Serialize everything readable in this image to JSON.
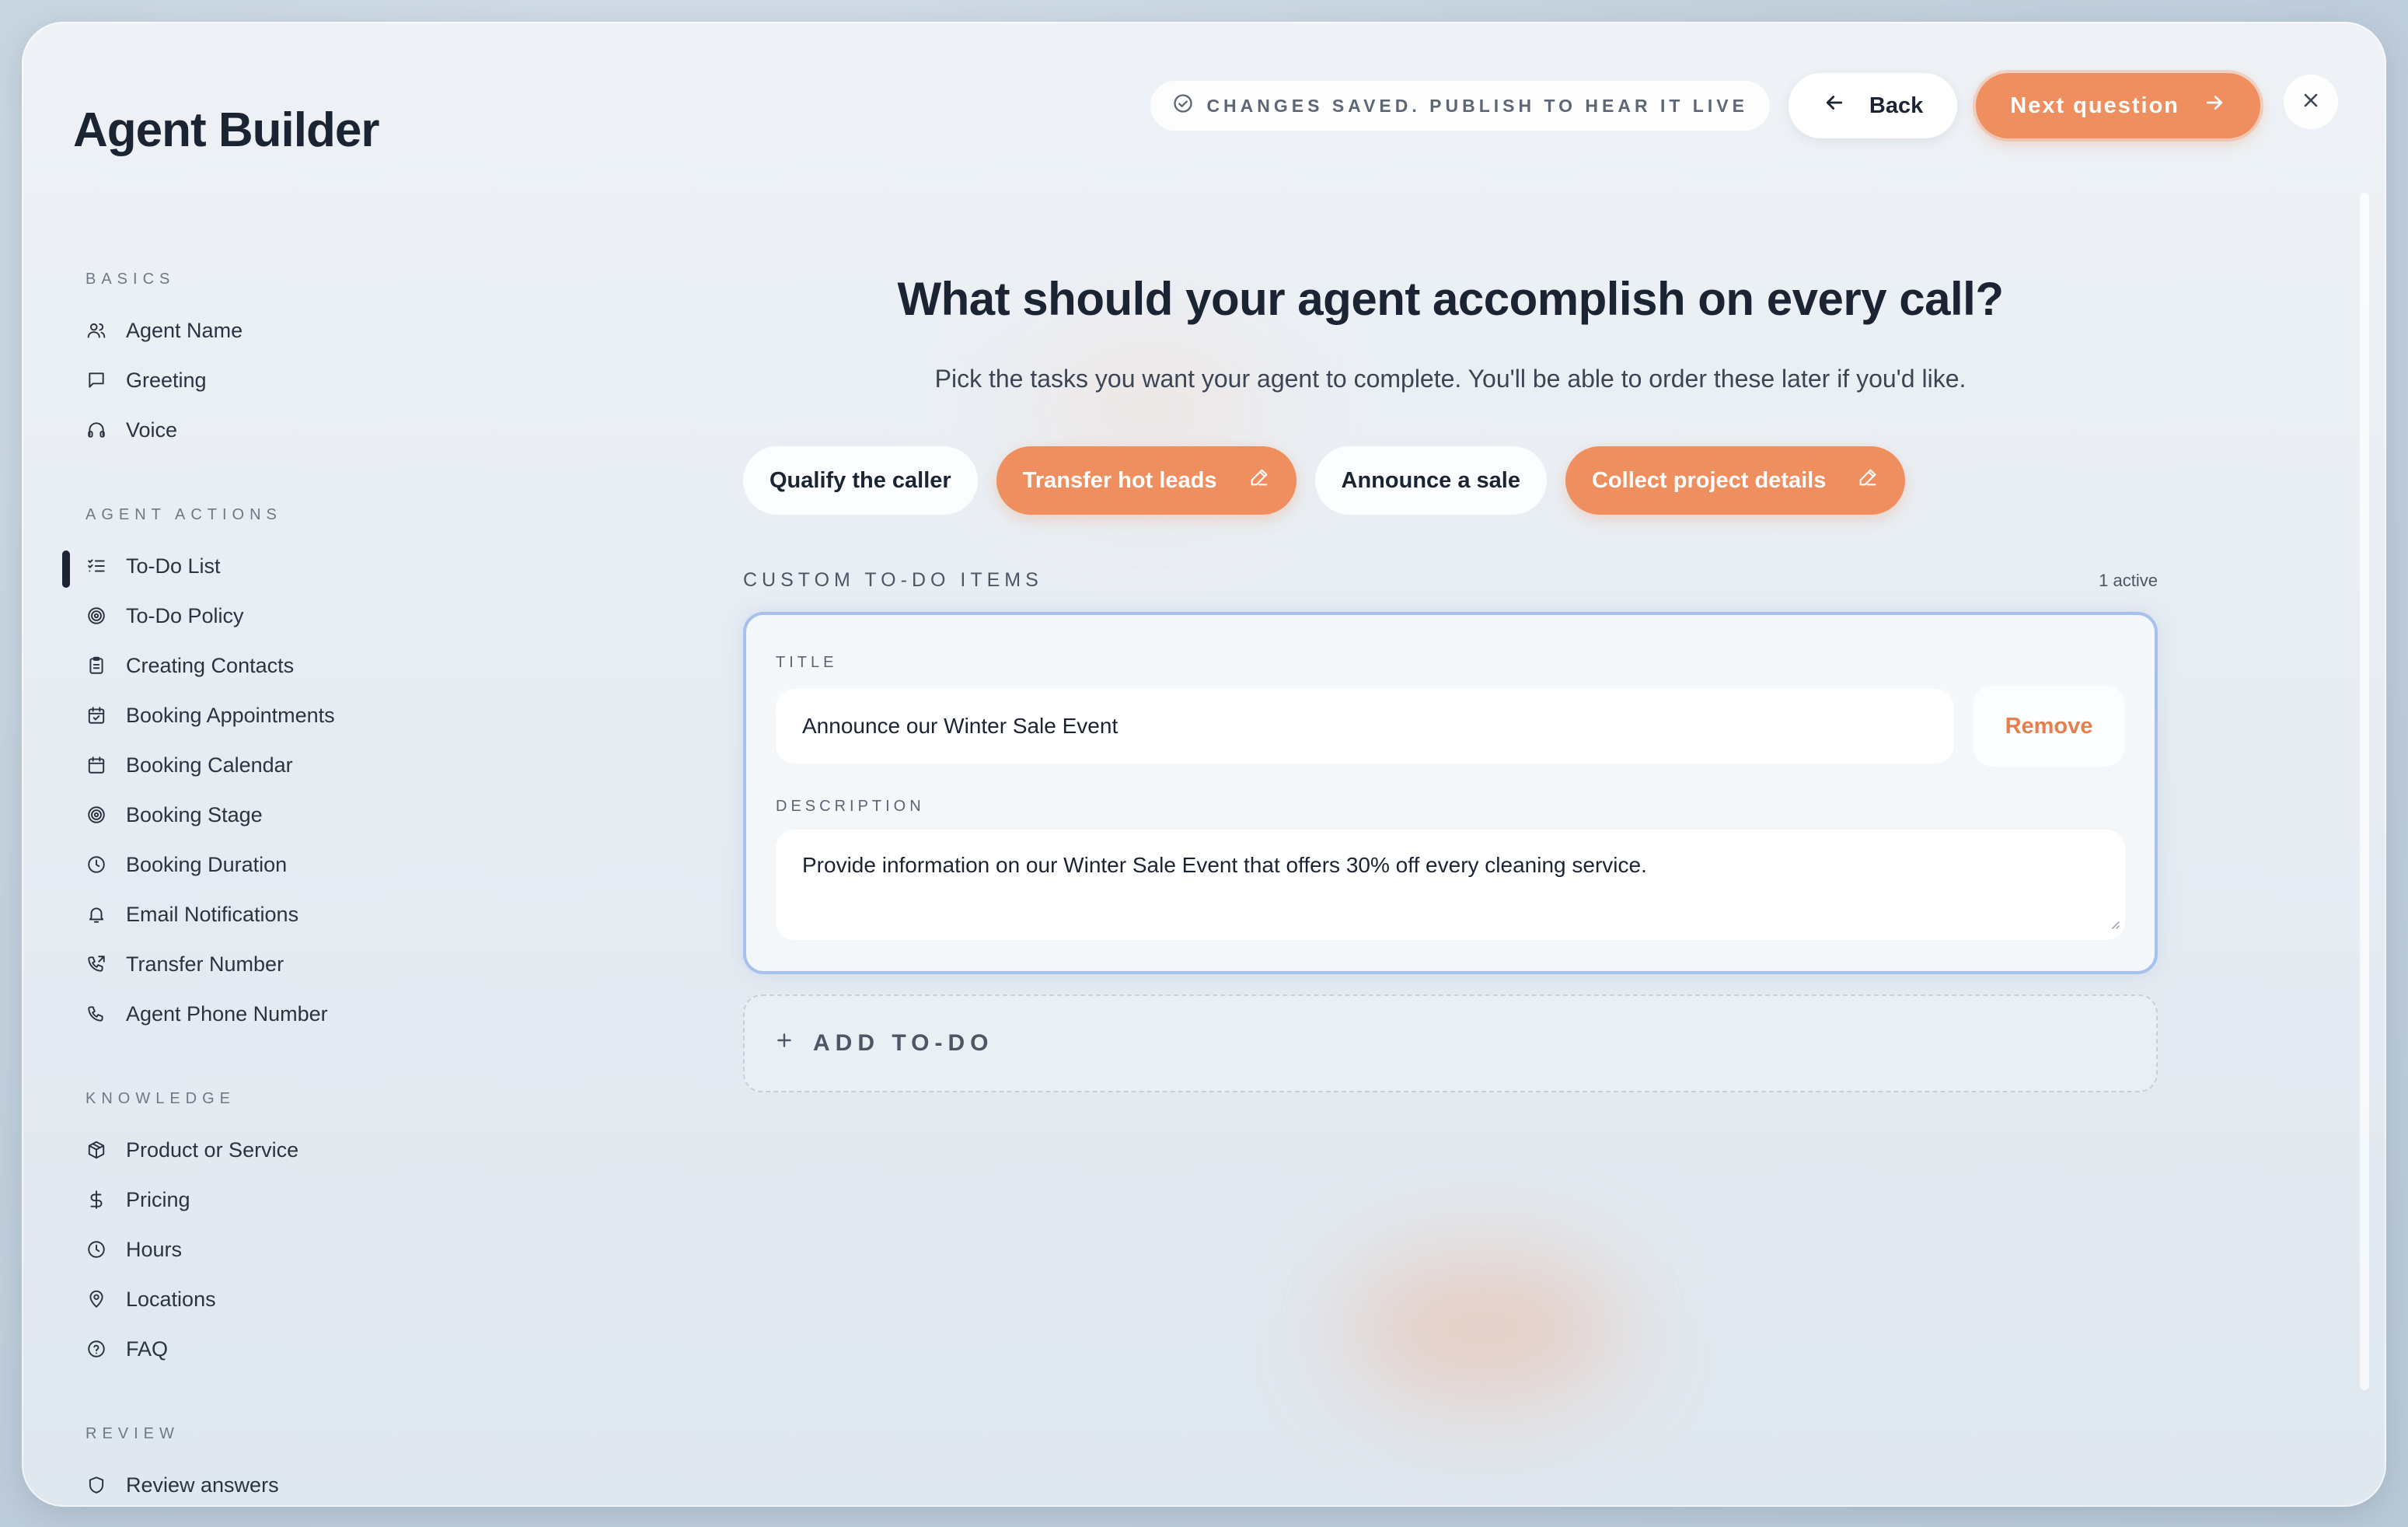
{
  "app": {
    "title": "Agent Builder"
  },
  "header": {
    "status": "CHANGES SAVED. PUBLISH TO HEAR IT LIVE",
    "back_label": "Back",
    "next_label": "Next question"
  },
  "sidebar": {
    "sections": [
      {
        "label": "BASICS",
        "items": [
          "Agent Name",
          "Greeting",
          "Voice"
        ]
      },
      {
        "label": "AGENT ACTIONS",
        "items": [
          "To-Do List",
          "To-Do Policy",
          "Creating Contacts",
          "Booking Appointments",
          "Booking Calendar",
          "Booking Stage",
          "Booking Duration",
          "Email Notifications",
          "Transfer Number",
          "Agent Phone Number"
        ]
      },
      {
        "label": "KNOWLEDGE",
        "items": [
          "Product or Service",
          "Pricing",
          "Hours",
          "Locations",
          "FAQ"
        ]
      },
      {
        "label": "REVIEW",
        "items": [
          "Review answers"
        ]
      }
    ],
    "active_item": "To-Do List"
  },
  "main": {
    "question": "What should your agent accomplish on every call?",
    "subtitle": "Pick the tasks you want your agent to complete. You'll be able to order these later if you'd like.",
    "chips": [
      {
        "label": "Qualify the caller",
        "selected": false
      },
      {
        "label": "Transfer hot leads",
        "selected": true
      },
      {
        "label": "Announce a sale",
        "selected": false
      },
      {
        "label": "Collect project details",
        "selected": true
      }
    ],
    "custom_label": "CUSTOM TO-DO ITEMS",
    "active_count": "1 active",
    "todo": {
      "title_label": "TITLE",
      "title_value": "Announce our Winter Sale Event",
      "remove_label": "Remove",
      "description_label": "DESCRIPTION",
      "description_value": "Provide information on our Winter Sale Event that offers 30% off every cleaning service."
    },
    "add_todo_label": "ADD TO-DO"
  },
  "colors": {
    "accent": "#ef8e5e",
    "text": "#1b2433",
    "focus_border": "#a7c1ec",
    "remove": "#e57f4d"
  }
}
